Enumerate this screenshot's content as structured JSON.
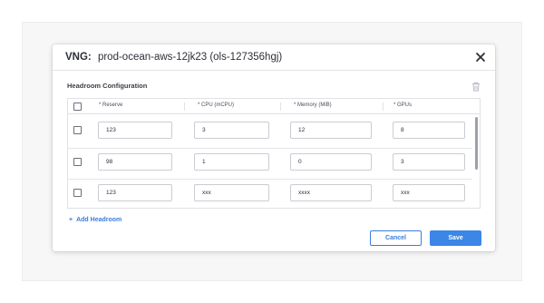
{
  "modal": {
    "title_prefix": "VNG:",
    "title_name": "prod-ocean-aws-12jk23 (ols-127356hgj)",
    "section_title": "Headroom Configuration",
    "columns": [
      "* Reserve",
      "* CPU (mCPU)",
      "* Memory (MiB)",
      "* GPUs"
    ],
    "rows": [
      {
        "reserve": "123",
        "cpu": "3",
        "memory": "12",
        "gpus": "8"
      },
      {
        "reserve": "98",
        "cpu": "1",
        "memory": "0",
        "gpus": "3"
      },
      {
        "reserve": "123",
        "cpu": "xxx",
        "memory": "xxxx",
        "gpus": "xxx"
      }
    ],
    "add_label": "Add Headroom",
    "cancel_label": "Cancel",
    "save_label": "Save"
  },
  "icons": {
    "close": "close-icon",
    "trash": "trash-icon",
    "plus": "plus-icon"
  },
  "colors": {
    "accent": "#3b86e6",
    "link": "#3b7ddd"
  }
}
